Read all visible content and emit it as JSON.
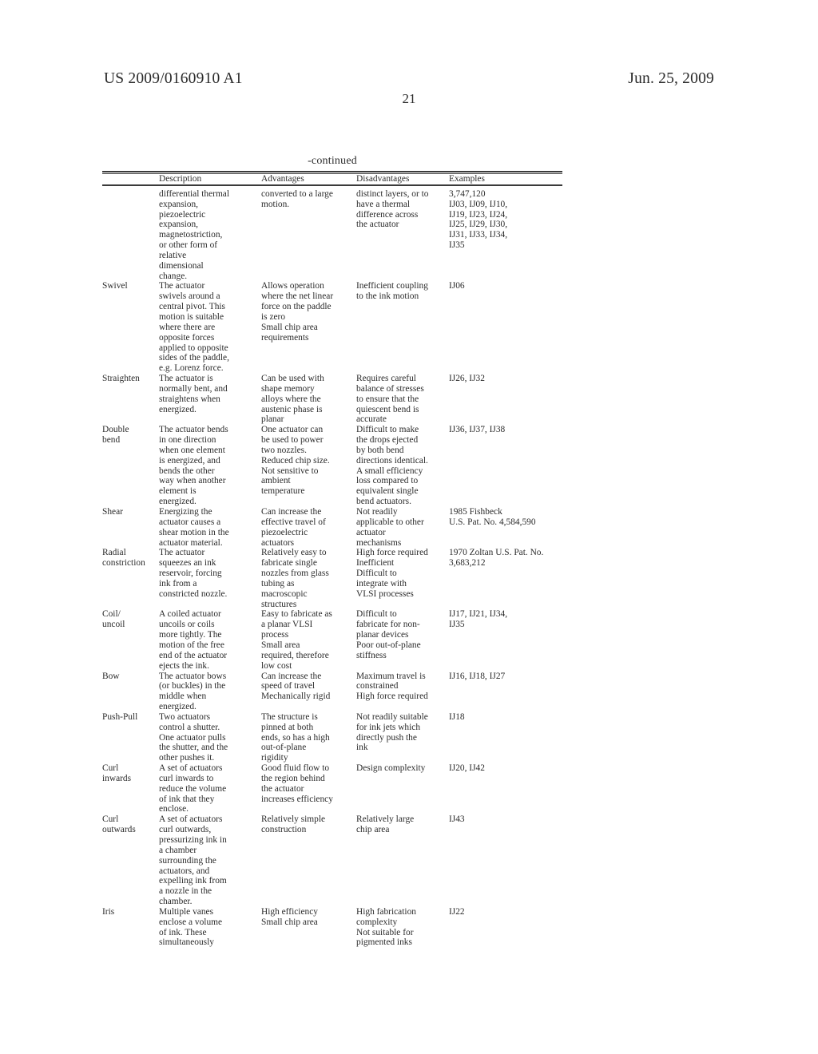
{
  "header": {
    "publication_number": "US 2009/0160910 A1",
    "publication_date": "Jun. 25, 2009",
    "page_number": "21"
  },
  "table": {
    "continued_label": "-continued",
    "columns": [
      "",
      "Description",
      "Advantages",
      "Disadvantages",
      "Examples"
    ],
    "rows": [
      {
        "label": "",
        "description": "differential thermal\nexpansion,\npiezoelectric\nexpansion,\nmagnetostriction,\nor other form of\nrelative\ndimensional\nchange.",
        "advantages": "converted to a large\nmotion.",
        "disadvantages": "distinct layers, or to\nhave a thermal\ndifference across\nthe actuator",
        "examples": "3,747,120\nIJ03, IJ09, IJ10,\nIJ19, IJ23, IJ24,\nIJ25, IJ29, IJ30,\nIJ31, IJ33, IJ34,\nIJ35"
      },
      {
        "label": "Swivel",
        "description": "The actuator\nswivels around a\ncentral pivot. This\nmotion is suitable\nwhere there are\nopposite forces\napplied to opposite\nsides of the paddle,\ne.g. Lorenz force.",
        "advantages": "Allows operation\nwhere the net linear\nforce on the paddle\nis zero\nSmall chip area\nrequirements",
        "disadvantages": "Inefficient coupling\nto the ink motion",
        "examples": "IJ06"
      },
      {
        "label": "Straighten",
        "description": "The actuator is\nnormally bent, and\nstraightens when\nenergized.",
        "advantages": "Can be used with\nshape memory\nalloys where the\naustenic phase is\nplanar",
        "disadvantages": "Requires careful\nbalance of stresses\nto ensure that the\nquiescent bend is\naccurate",
        "examples": "IJ26, IJ32"
      },
      {
        "label": "Double\nbend",
        "description": "The actuator bends\nin one direction\nwhen one element\nis energized, and\nbends the other\nway when another\nelement is\nenergized.",
        "advantages": "One actuator can\nbe used to power\ntwo nozzles.\nReduced chip size.\nNot sensitive to\nambient\ntemperature",
        "disadvantages": "Difficult to make\nthe drops ejected\nby both bend\ndirections identical.\nA small efficiency\nloss compared to\nequivalent single\nbend actuators.",
        "examples": "IJ36, IJ37, IJ38"
      },
      {
        "label": "Shear",
        "description": "Energizing the\nactuator causes a\nshear motion in the\nactuator material.",
        "advantages": "Can increase the\neffective travel of\npiezoelectric\nactuators",
        "disadvantages": "Not readily\napplicable to other\nactuator\nmechanisms",
        "examples": "1985 Fishbeck\nU.S. Pat. No. 4,584,590"
      },
      {
        "label": "Radial\nconstriction",
        "description": "The actuator\nsqueezes an ink\nreservoir, forcing\nink from a\nconstricted nozzle.",
        "advantages": "Relatively easy to\nfabricate single\nnozzles from glass\ntubing as\nmacroscopic\nstructures",
        "disadvantages": "High force required\nInefficient\nDifficult to\nintegrate with\nVLSI processes",
        "examples": "1970 Zoltan U.S. Pat. No.\n3,683,212"
      },
      {
        "label": "Coil/\nuncoil",
        "description": "A coiled actuator\nuncoils or coils\nmore tightly. The\nmotion of the free\nend of the actuator\nejects the ink.",
        "advantages": "Easy to fabricate as\na planar VLSI\nprocess\nSmall area\nrequired, therefore\nlow cost",
        "disadvantages": "Difficult to\nfabricate for non-\nplanar devices\nPoor out-of-plane\nstiffness",
        "examples": "IJ17, IJ21, IJ34,\nIJ35"
      },
      {
        "label": "Bow",
        "description": "The actuator bows\n(or buckles) in the\nmiddle when\nenergized.",
        "advantages": "Can increase the\nspeed of travel\nMechanically rigid",
        "disadvantages": "Maximum travel is\nconstrained\nHigh force required",
        "examples": "IJ16, IJ18, IJ27"
      },
      {
        "label": "Push-Pull",
        "description": "Two actuators\ncontrol a shutter.\nOne actuator pulls\nthe shutter, and the\nother pushes it.",
        "advantages": "The structure is\npinned at both\nends, so has a high\nout-of-plane\nrigidity",
        "disadvantages": "Not readily suitable\nfor ink jets which\ndirectly push the\nink",
        "examples": "IJ18"
      },
      {
        "label": "Curl\ninwards",
        "description": "A set of actuators\ncurl inwards to\nreduce the volume\nof ink that they\nenclose.",
        "advantages": "Good fluid flow to\nthe region behind\nthe actuator\nincreases efficiency",
        "disadvantages": "Design complexity",
        "examples": "IJ20, IJ42"
      },
      {
        "label": "Curl\noutwards",
        "description": "A set of actuators\ncurl outwards,\npressurizing ink in\na chamber\nsurrounding the\nactuators, and\nexpelling ink from\na nozzle in the\nchamber.",
        "advantages": "Relatively simple\nconstruction",
        "disadvantages": "Relatively large\nchip area",
        "examples": "IJ43"
      },
      {
        "label": "Iris",
        "description": "Multiple vanes\nenclose a volume\nof ink. These\nsimultaneously",
        "advantages": "High efficiency\nSmall chip area",
        "disadvantages": "High fabrication\ncomplexity\nNot suitable for\npigmented inks",
        "examples": "IJ22"
      }
    ]
  }
}
